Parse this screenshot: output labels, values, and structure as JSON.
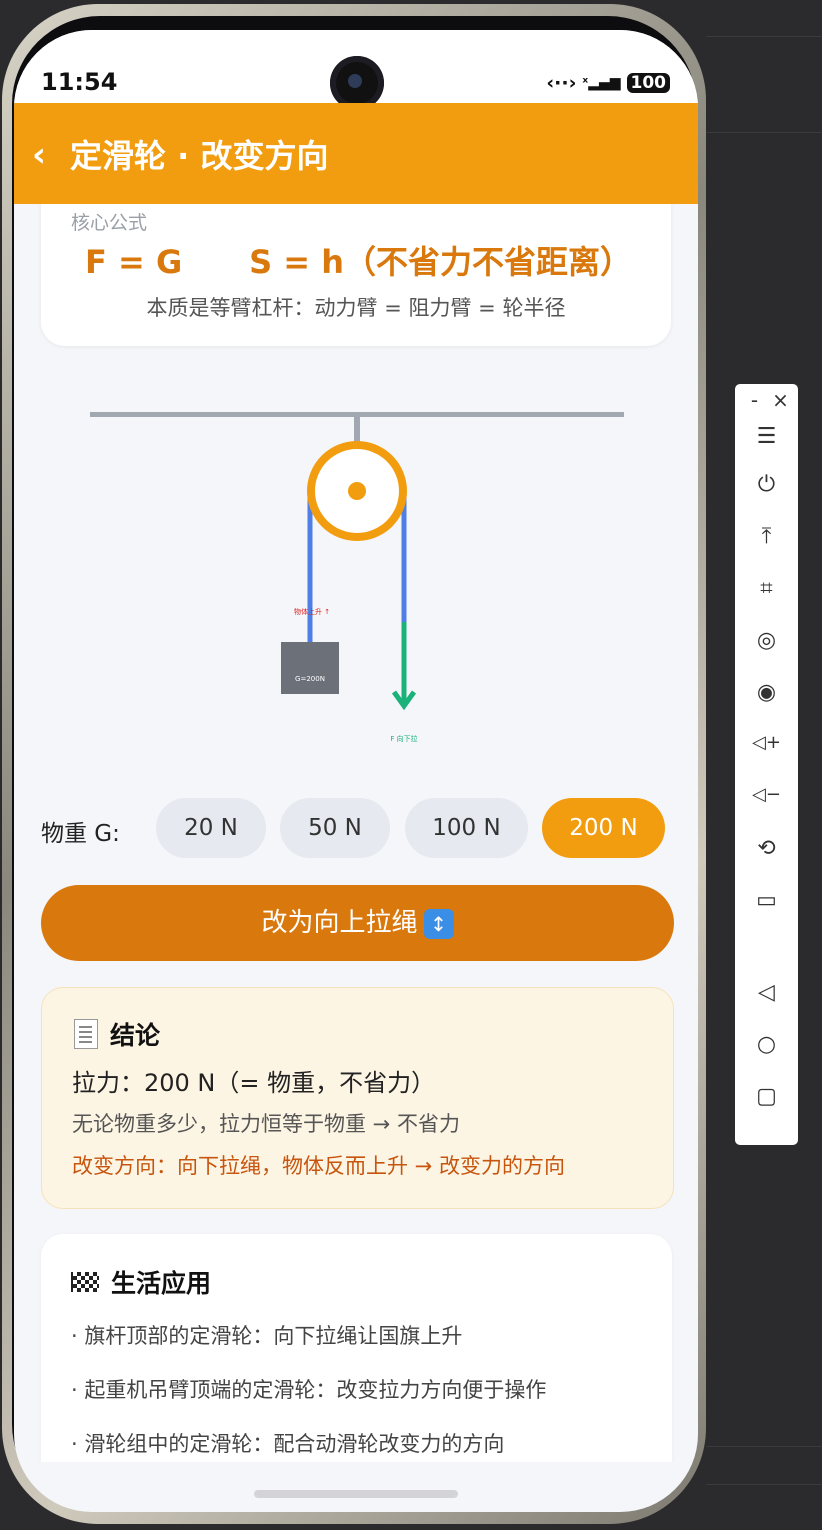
{
  "status": {
    "time": "11:54",
    "battery": "100"
  },
  "header": {
    "title": "定滑轮 · 改变方向"
  },
  "formula": {
    "label": "核心公式",
    "main": "F = G      S = h（不省力不省距离）",
    "note": "本质是等臂杠杆：动力臂 = 阻力臂 = 轮半径"
  },
  "diagram": {
    "object_label": "物体上升 ↑",
    "weight_label": "G=200N",
    "force_label": "F 向下拉"
  },
  "weights": {
    "label": "物重 G:",
    "options": [
      "20 N",
      "50 N",
      "100 N",
      "200 N"
    ],
    "selected": "200 N"
  },
  "toggle_button": {
    "label": "改为向上拉绳",
    "icon": "up-down-arrow-icon"
  },
  "conclusion": {
    "title": "结论",
    "icon": "receipt-icon",
    "line1": "拉力：200 N（= 物重，不省力）",
    "line2": "无论物重多少，拉力恒等于物重 → 不省力",
    "line3": "改变方向：向下拉绳，物体反而上升 → 改变力的方向"
  },
  "applications": {
    "title": "生活应用",
    "icon": "checkered-flag-icon",
    "items": [
      "· 旗杆顶部的定滑轮：向下拉绳让国旗上升",
      "· 起重机吊臂顶端的定滑轮：改变拉力方向便于操作",
      "· 滑轮组中的定滑轮：配合动滑轮改变力的方向"
    ]
  },
  "side_toolbar": {
    "minimize": "-",
    "close": "×",
    "icons": [
      "menu-icon",
      "power-icon",
      "pin-top-icon",
      "crop-icon",
      "screenshot-icon",
      "record-icon",
      "volume-up-icon",
      "volume-down-icon",
      "rotate-icon",
      "device-icon",
      "back-icon",
      "home-icon",
      "recents-icon"
    ]
  },
  "colors": {
    "accent": "#f29d0f",
    "accent_dark": "#d9780c",
    "rope": "#4f7fe6",
    "pull": "#1bb27a"
  }
}
